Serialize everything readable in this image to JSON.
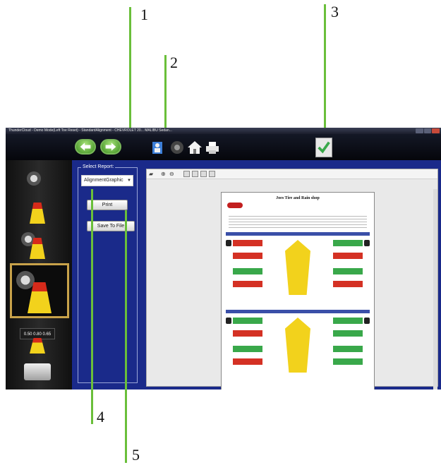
{
  "callouts": [
    "1",
    "2",
    "3",
    "4",
    "5"
  ],
  "window": {
    "title": "ThunderCloud - Demo Mode(Left Toe Reset) - StandardAlignment - CHEVROLET 20... MALIBU Sedan..."
  },
  "toolbar": {
    "icons": [
      "back-arrow-icon",
      "forward-arrow-icon",
      "info-person-icon",
      "tire-icon",
      "home-icon",
      "print-icon",
      "checkmark-icon"
    ]
  },
  "leftnav": {
    "gauge_values": "0.50 0.80 0.65"
  },
  "report": {
    "legend": "Select Report:",
    "selected": "AlignmentGraphic",
    "print_label": "Print",
    "save_label": "Save To File"
  },
  "document": {
    "shop_name": "Joes Tire and Rain shop"
  },
  "colors": {
    "accent_green": "#6abf3a",
    "panel_blue": "#1a2a8a",
    "nav_gold": "#c8a24a"
  }
}
